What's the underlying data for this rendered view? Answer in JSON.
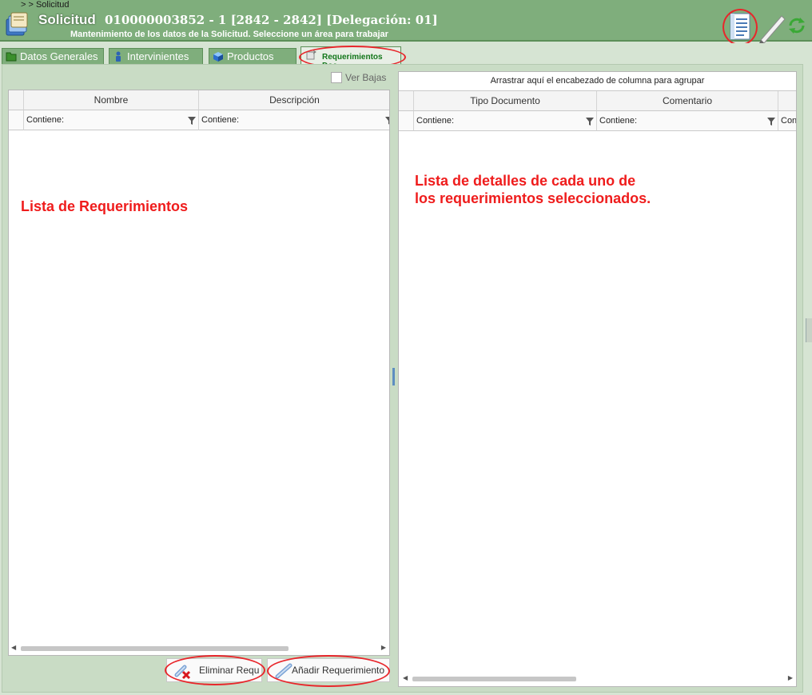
{
  "header": {
    "breadcrumb": ">  > Solicitud",
    "title": "Solicitud",
    "title_detail": "010000003852 - 1 [2842 - 2842] [Delegación: 01]",
    "subtitle": "Mantenimiento de los datos de la Solicitud. Seleccione un área para trabajar"
  },
  "tabs": [
    {
      "label": "Datos Generales",
      "icon": "folder-icon"
    },
    {
      "label": "Intervinientes",
      "icon": "person-icon"
    },
    {
      "label": "Productos",
      "icon": "cube-icon"
    },
    {
      "label": "Requerimientos Doc",
      "icon": "document-arrow-icon",
      "active": true
    }
  ],
  "left_panel": {
    "ver_bajas_label": "Ver Bajas",
    "columns": [
      "Nombre",
      "Descripción"
    ],
    "filter_text": "Contiene:",
    "annotation": "Lista de Requerimientos",
    "buttons": {
      "eliminar": "Eliminar Requ",
      "anadir": "Añadir Requerimiento"
    }
  },
  "right_panel": {
    "group_hint": "Arrastrar aquí el encabezado de columna para agrupar",
    "columns": [
      "Tipo Documento",
      "Comentario"
    ],
    "filter_text": "Contiene:",
    "filter_partial": "Con",
    "annotation_line1": "Lista de detalles de cada uno de",
    "annotation_line2": "los requerimientos seleccionados."
  },
  "colors": {
    "header_green": "#7fae7c",
    "active_tab_text": "#12761a",
    "annotation_red": "#ef1c1c"
  }
}
